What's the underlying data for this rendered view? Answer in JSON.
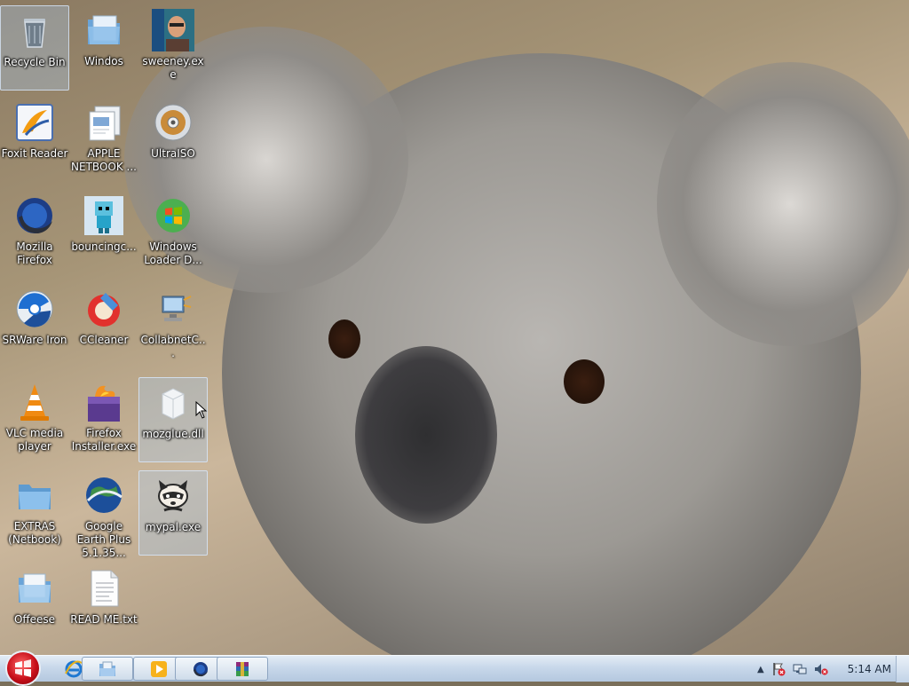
{
  "desktop": {
    "icons": [
      {
        "label": "Recycle Bin",
        "icon": "recycle-bin-icon"
      },
      {
        "label": "Windos",
        "icon": "folder-icon"
      },
      {
        "label": "sweeney.exe",
        "icon": "person-photo-icon"
      },
      {
        "label": "Foxit Reader",
        "icon": "foxit-reader-icon"
      },
      {
        "label": "APPLE NETBOOK ...",
        "icon": "document-stack-icon"
      },
      {
        "label": "UltraISO",
        "icon": "disc-icon"
      },
      {
        "label": "Mozilla Firefox",
        "icon": "firefox-icon"
      },
      {
        "label": "bouncingc...",
        "icon": "pixel-character-icon"
      },
      {
        "label": "Windows Loader D...",
        "icon": "windows-orb-icon"
      },
      {
        "label": "SRWare Iron",
        "icon": "iron-browser-icon"
      },
      {
        "label": "CCleaner",
        "icon": "ccleaner-icon"
      },
      {
        "label": "CollabnetC...",
        "icon": "network-computer-icon"
      },
      {
        "label": "VLC media player",
        "icon": "vlc-cone-icon"
      },
      {
        "label": "Firefox Installer.exe",
        "icon": "firefox-installer-icon"
      },
      {
        "label": "mozglue.dll",
        "icon": "dll-file-icon"
      },
      {
        "label": "EXTRAS (Netbook)",
        "icon": "folder-icon"
      },
      {
        "label": "Google Earth Plus 5.1.35...",
        "icon": "google-earth-icon"
      },
      {
        "label": "mypal.exe",
        "icon": "raccoon-icon"
      },
      {
        "label": "Offeese",
        "icon": "folder-icon"
      },
      {
        "label": "READ ME.txt",
        "icon": "text-file-icon"
      }
    ]
  },
  "taskbar": {
    "start": {
      "icon": "start-orb-icon"
    },
    "pinned": [
      {
        "icon": "internet-explorer-icon"
      },
      {
        "icon": "explorer-folder-icon"
      },
      {
        "icon": "media-player-icon"
      },
      {
        "icon": "firefox-icon"
      },
      {
        "icon": "winrar-icon"
      }
    ],
    "tray": {
      "icons": [
        "show-hidden-icons-icon",
        "action-center-flag-icon",
        "network-icon",
        "volume-muted-icon"
      ],
      "clock": "5:14 AM"
    }
  },
  "colors": {
    "taskbar_top": "#e3ecf5",
    "taskbar_bottom": "#b4c8df",
    "start_orb": "#c80f1a",
    "selection": "#aac8eb"
  }
}
